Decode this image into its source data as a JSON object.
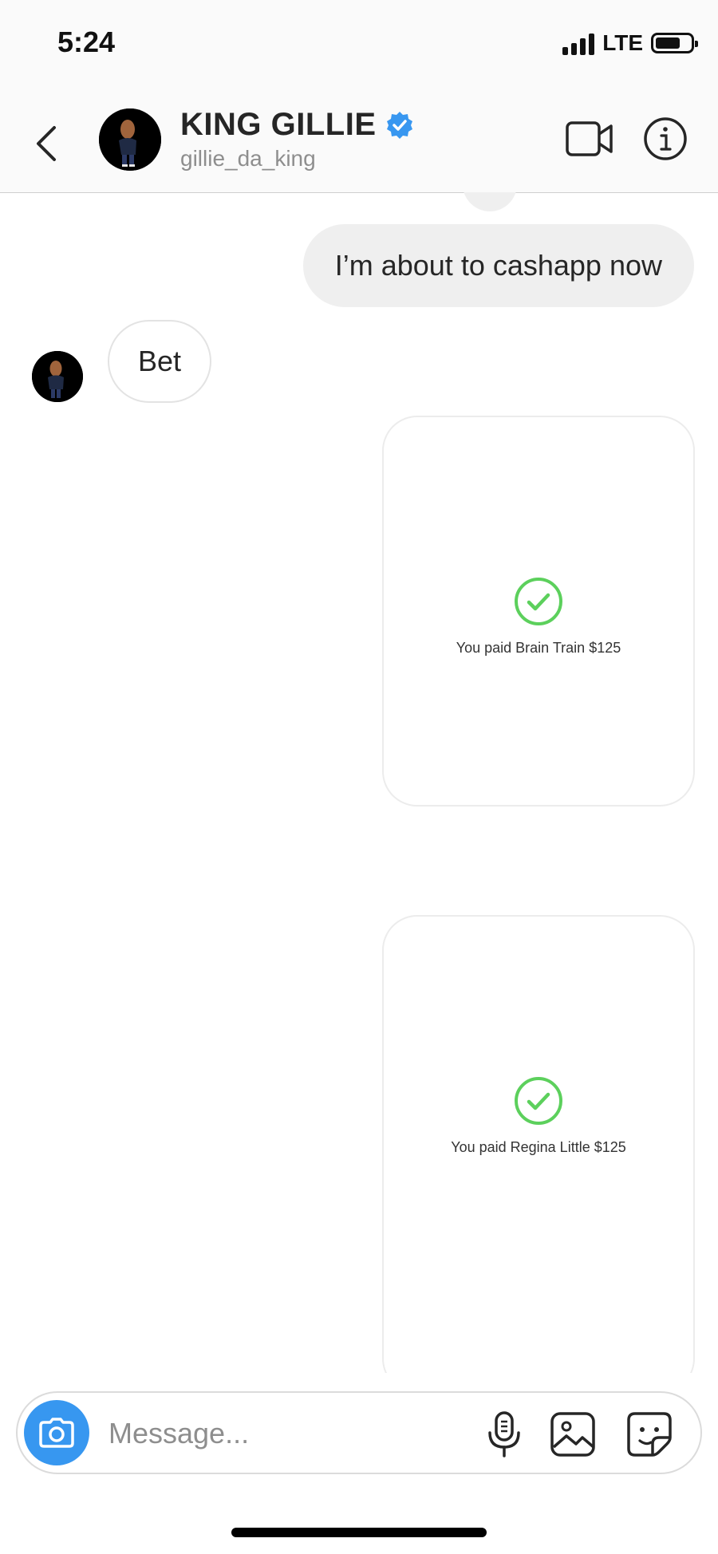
{
  "status_bar": {
    "time": "5:24",
    "network": "LTE",
    "signal_icon": "signal-bars-icon",
    "battery_icon": "battery-icon"
  },
  "header": {
    "title": "KING GILLIE",
    "subtitle": "gillie_da_king",
    "verified_badge_color": "#3897f0",
    "icons": [
      "back-chevron-icon",
      "video-call-icon",
      "info-icon"
    ]
  },
  "messages": [
    {
      "direction": "outgoing",
      "text": "I’m about to cashapp now"
    },
    {
      "direction": "incoming",
      "text": "Bet"
    }
  ],
  "payments": [
    {
      "text": "You paid Brain Train $125",
      "status_color": "#5cd05c"
    },
    {
      "text": "You paid Regina Little $125",
      "status_color": "#5cd05c"
    }
  ],
  "composer": {
    "placeholder": "Message...",
    "camera_button_color": "#3797f0",
    "icons": [
      "camera-icon",
      "microphone-icon",
      "gallery-icon",
      "sticker-icon"
    ]
  }
}
